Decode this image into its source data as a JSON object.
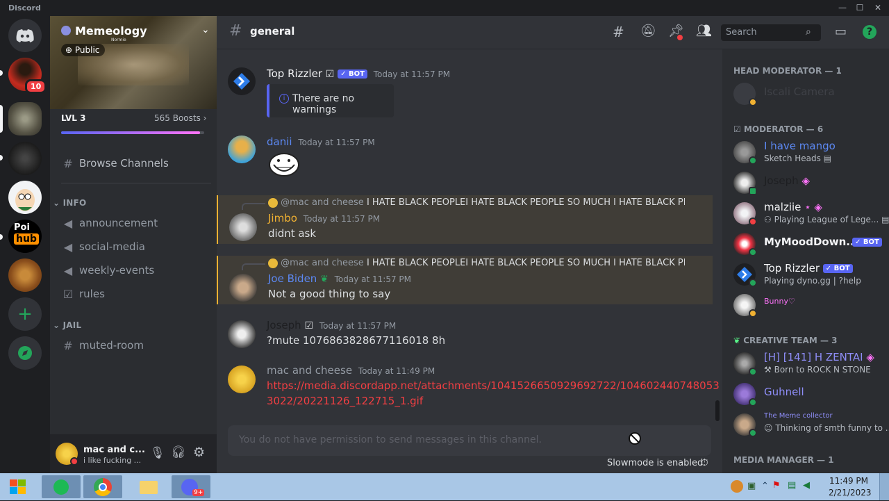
{
  "window": {
    "title": "Discord"
  },
  "rail": {
    "badge": "10",
    "poi_label": "Poi",
    "hub_label": "hub"
  },
  "server": {
    "name": "Memeology",
    "subtitle": "Normie",
    "visibility": "Public",
    "level": "LVL 3",
    "boosts": "565 Boosts",
    "boost_progress": 0.97
  },
  "sidebar": {
    "browse": "Browse Channels",
    "categories": [
      {
        "name": "INFO",
        "channels": [
          "announcement",
          "social-media",
          "weekly-events",
          "rules"
        ]
      },
      {
        "name": "JAIL",
        "channels": [
          "muted-room"
        ]
      }
    ]
  },
  "user": {
    "name": "mac and c...",
    "status": "i like fucking ..."
  },
  "channel": {
    "name": "general",
    "search_placeholder": "Search"
  },
  "messages": [
    {
      "author": "Top Rizzler",
      "bot": "BOT",
      "time": "Today at 11:57 PM",
      "embed": "There are no warnings"
    },
    {
      "author": "danii",
      "time": "Today at 11:57 PM"
    },
    {
      "reply_to": "@mac and cheese",
      "reply_text": "I HATE BLACK PEOPLEI HATE BLACK PEOPLE SO MUCH I HATE BLACK PEOF",
      "author": "Jimbo",
      "time": "Today at 11:57 PM",
      "text": "didnt ask"
    },
    {
      "reply_to": "@mac and cheese",
      "reply_text": "I HATE BLACK PEOPLEI HATE BLACK PEOPLE SO MUCH I HATE BLACK PEOF",
      "author": "Joe Biden",
      "time": "Today at 11:57 PM",
      "text": "Not a good thing to say"
    },
    {
      "author": "Joseph",
      "time": "Today at 11:57 PM",
      "text": "?mute 1076863828677116018 8h"
    },
    {
      "author": "mac and cheese",
      "time": "Today at 11:49 PM",
      "link1": "https://media.discordapp.net/attachments/1041526650929692722/104602440748053",
      "link2": "3022/20221126_122715_1.gif"
    }
  ],
  "composer": {
    "placeholder": "You do not have permission to send messages in this channel.",
    "slowmode": "Slowmode is enabled."
  },
  "members": {
    "groups": [
      {
        "title": "HEAD MODERATOR — 1",
        "items": [
          {
            "name": "Iscali Camera",
            "sub": ""
          }
        ]
      },
      {
        "title": "MODERATOR — 6",
        "items": [
          {
            "name": "I have mango",
            "sub": "Sketch Heads"
          },
          {
            "name": "Joseph",
            "sub": ""
          },
          {
            "name": "malziie",
            "sub": "Playing League of Lege..."
          },
          {
            "name": "MyMoodDown...",
            "sub": "",
            "bot": "BOT"
          },
          {
            "name": "Top Rizzler",
            "sub": "Playing dyno.gg | ?help",
            "bot": "BOT"
          },
          {
            "name": "Bunny♡",
            "sub": ""
          }
        ]
      },
      {
        "title": "CREATIVE TEAM — 3",
        "items": [
          {
            "name": "[H] [141] H ZENTAI",
            "sub": "Born to ROCK N STONE"
          },
          {
            "name": "Guhnell",
            "sub": ""
          },
          {
            "name": "The Meme collector",
            "sub": "Thinking of smth funny to ..."
          }
        ]
      },
      {
        "title": "MEDIA MANAGER — 1",
        "items": []
      }
    ]
  },
  "taskbar": {
    "time": "11:49 PM",
    "date": "2/21/2023",
    "discord_badge": "9+"
  },
  "colors": {
    "blurple": "#5865f2",
    "green": "#23a55a",
    "gold": "#f0b132",
    "link": "#f23f43"
  }
}
